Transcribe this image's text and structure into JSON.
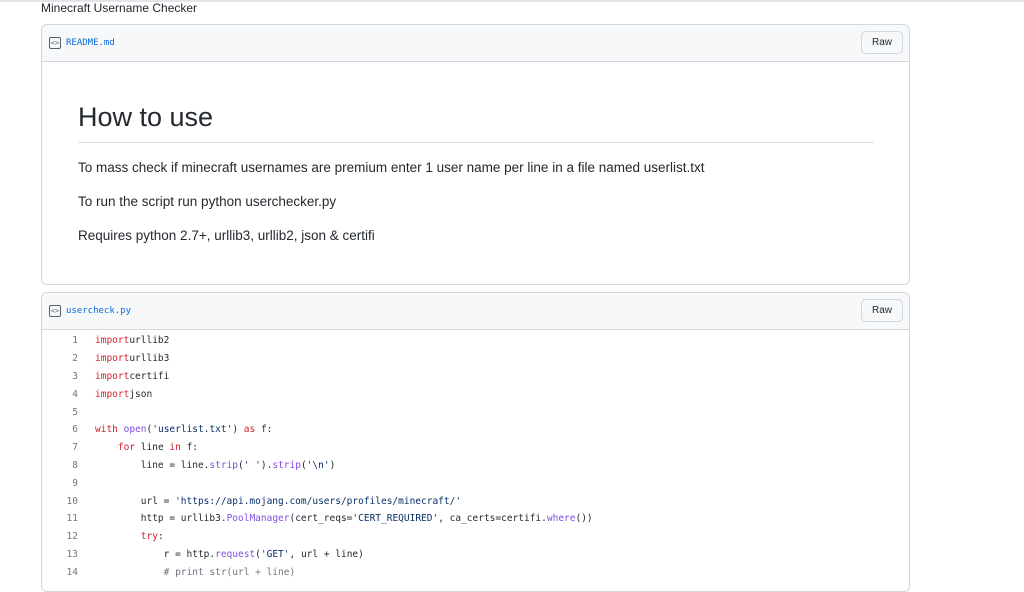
{
  "page": {
    "title": "Minecraft Username Checker"
  },
  "readme": {
    "file_name": "README.md",
    "raw_label": "Raw",
    "heading": "How to use",
    "paragraphs": [
      "To mass check if minecraft usernames are premium enter 1 user name per line in a file named userlist.txt",
      "To run the script run python userchecker.py",
      "Requires python 2.7+, urllib3, urllib2, json & certifi"
    ]
  },
  "code_file": {
    "file_name": "usercheck.py",
    "raw_label": "Raw",
    "lines": [
      {
        "n": "1",
        "tokens": [
          [
            "kw",
            "import"
          ],
          [
            "",
            "urllib2"
          ]
        ]
      },
      {
        "n": "2",
        "tokens": [
          [
            "kw",
            "import"
          ],
          [
            "",
            "urllib3"
          ]
        ]
      },
      {
        "n": "3",
        "tokens": [
          [
            "kw",
            "import"
          ],
          [
            "",
            "certifi"
          ]
        ]
      },
      {
        "n": "4",
        "tokens": [
          [
            "kw",
            "import"
          ],
          [
            "",
            "json"
          ]
        ]
      },
      {
        "n": "5",
        "tokens": []
      },
      {
        "n": "6",
        "tokens": [
          [
            "kw",
            "with"
          ],
          [
            "",
            " "
          ],
          [
            "fn",
            "open"
          ],
          [
            "",
            "("
          ],
          [
            "st",
            "'userlist.txt'"
          ],
          [
            "",
            ") "
          ],
          [
            "kw",
            "as"
          ],
          [
            "",
            " f:"
          ]
        ]
      },
      {
        "n": "7",
        "tokens": [
          [
            "",
            "    "
          ],
          [
            "kw",
            "for"
          ],
          [
            "",
            " line "
          ],
          [
            "kw",
            "in"
          ],
          [
            "",
            " f:"
          ]
        ]
      },
      {
        "n": "8",
        "tokens": [
          [
            "",
            "        line = line."
          ],
          [
            "fn",
            "strip"
          ],
          [
            "",
            "("
          ],
          [
            "st",
            "' '"
          ],
          [
            "",
            ")."
          ],
          [
            "fn",
            "strip"
          ],
          [
            "",
            "("
          ],
          [
            "st",
            "'\\n'"
          ],
          [
            "",
            ")"
          ]
        ]
      },
      {
        "n": "9",
        "tokens": []
      },
      {
        "n": "10",
        "tokens": [
          [
            "",
            "        url = "
          ],
          [
            "st",
            "'https://api.mojang.com/users/profiles/minecraft/'"
          ]
        ]
      },
      {
        "n": "11",
        "tokens": [
          [
            "",
            "        http = urllib3."
          ],
          [
            "fn",
            "PoolManager"
          ],
          [
            "",
            "(cert_reqs="
          ],
          [
            "st",
            "'CERT_REQUIRED'"
          ],
          [
            "",
            ", ca_certs=certifi."
          ],
          [
            "fn",
            "where"
          ],
          [
            "",
            "())"
          ]
        ]
      },
      {
        "n": "12",
        "tokens": [
          [
            "",
            "        "
          ],
          [
            "kw",
            "try"
          ],
          [
            "",
            ":"
          ]
        ]
      },
      {
        "n": "13",
        "tokens": [
          [
            "",
            "            r = http."
          ],
          [
            "fn",
            "request"
          ],
          [
            "",
            "("
          ],
          [
            "st",
            "'GET'"
          ],
          [
            "",
            ", url + line)"
          ]
        ]
      },
      {
        "n": "14",
        "tokens": [
          [
            "",
            "            "
          ],
          [
            "cm",
            "# print str(url + line)"
          ]
        ]
      }
    ]
  }
}
